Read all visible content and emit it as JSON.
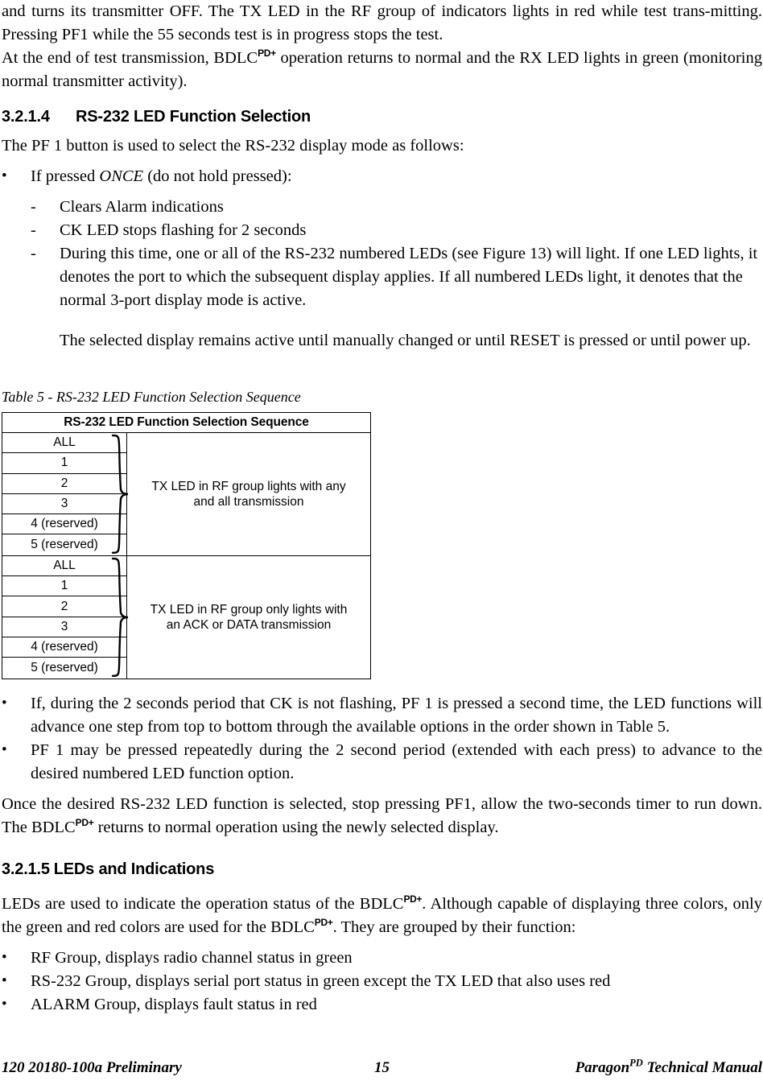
{
  "page": {
    "intro_paragraphs": [
      "and turns its transmitter OFF. The TX LED in the RF group of indicators lights in red while test transmitting. Pressing PF1 while the 55 seconds test is in progress stops the test.",
      "At the end of test transmission, BDLC operation returns to normal and the RX LED lights in green (monitoring normal transmitter activity)."
    ],
    "intro_para1_a": "and turns its transmitter OFF. The TX LED in the RF group of indicators lights in red while test trans-",
    "intro_para1_b": "mitting. Pressing PF1 while the 55 seconds test is in progress stops the test.",
    "intro_para2_a": "At the end of test transmission, BDLC",
    "intro_para2_sup": "PD+",
    "intro_para2_b": " operation returns to normal and the RX LED lights in green (monitoring normal transmitter activity)."
  },
  "section_3214": {
    "number": "3.2.1.4",
    "title": "RS-232 LED Function Selection",
    "lead": "The PF 1 button is used to select the RS-232 display mode as follows:",
    "bullet_1_pre": "If pressed ",
    "bullet_1_em": "ONCE",
    "bullet_1_post": " (do not hold pressed):",
    "sub_items": [
      "Clears Alarm indications",
      "CK LED stops flashing for 2 seconds",
      "During this time, one or all of the RS-232 numbered LEDs (see Figure 13) will light. If one LED lights, it denotes the port to which the subsequent display applies. If all numbered LEDs light, it denotes that the normal 3-port display mode is active."
    ],
    "sub_item_3_continuation": "The selected display remains active until manually changed or until RESET is pressed or until power up."
  },
  "table_5": {
    "caption": "Table 5 - RS-232 LED Function Selection Sequence",
    "header": "RS-232 LED Function Selection Sequence",
    "blocks": [
      {
        "rows": [
          "ALL",
          "1",
          "2",
          "3",
          "4 (reserved)",
          "5 (reserved)"
        ],
        "description_line_1": "TX LED in RF group lights with any",
        "description_line_2": "and all transmission"
      },
      {
        "rows": [
          "ALL",
          "1",
          "2",
          "3",
          "4 (reserved)",
          "5 (reserved)"
        ],
        "description_line_1": "TX LED in RF group only lights with",
        "description_line_2": "an ACK or DATA transmission"
      }
    ]
  },
  "after_table": {
    "bullets": [
      "If, during the 2 seconds period that CK is not flashing, PF 1 is pressed a second time, the LED functions will advance one step from top to bottom through the available options in the order shown in Table 5.",
      "PF 1 may be pressed repeatedly during the 2 second period (extended with each press) to advance to the desired numbered LED function option."
    ],
    "closing_a": "Once the desired RS-232 LED function is selected, stop pressing PF1, allow the two-seconds timer to run down. The BDLC",
    "closing_sup": "PD+",
    "closing_b": " returns to normal operation using the newly selected display."
  },
  "section_3215": {
    "number": "3.2.1.5",
    "title": "LEDs and Indications",
    "para_a": "LEDs are used to indicate the operation status of the BDLC",
    "para_sup1": "PD+",
    "para_b": ". Although capable of displaying three colors, only the green and red colors are used for the BDLC",
    "para_sup2": "PD+",
    "para_c": ". They are grouped by their function:",
    "bullets": [
      "RF Group, displays radio channel status in green",
      "RS-232 Group, displays serial port status in green except the TX LED that also uses red",
      "ALARM Group, displays fault status in red"
    ]
  },
  "footer": {
    "left": "120 20180-100a Preliminary",
    "page_number": "15",
    "right_a": "Paragon",
    "right_sup": "PD",
    "right_b": " Technical Manual"
  }
}
